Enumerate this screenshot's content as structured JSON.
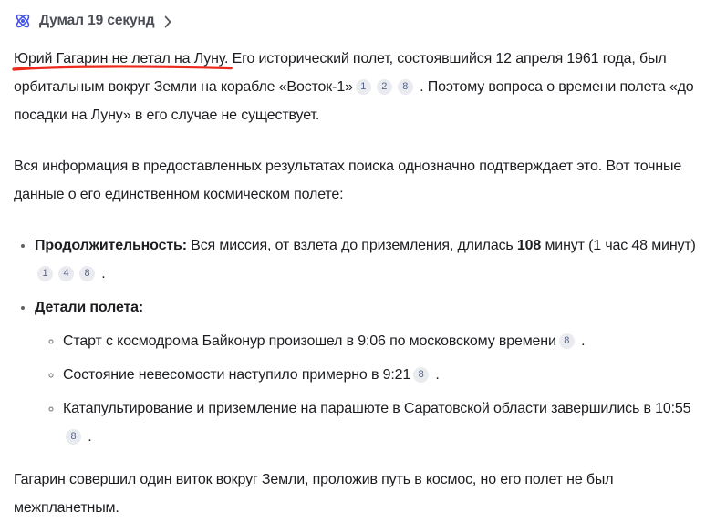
{
  "thinking_header": {
    "icon": "atom-icon",
    "label": "Думал 19 секунд"
  },
  "colors": {
    "accent_blue": "#4355e9",
    "underline_red": "#ee2a1c",
    "badge_bg": "#e9ebef",
    "badge_text": "#55648c",
    "body_text": "#1c1d21",
    "header_text": "#4a4d56"
  },
  "answer": {
    "p1": {
      "underlined": "Юрий Гагарин не летал на Луну.",
      "before_citations": " Его исторический полет, состоявшийся 12 апреля 1961 года, был орбитальным вокруг Земли на корабле «Восток-1»",
      "citations": [
        "1",
        "2",
        "8"
      ],
      "after_citations": " . Поэтому вопроса о времени полета «до посадки на Луну» в его случае не существует."
    },
    "p2": "Вся информация в предоставленных результатах поиска однозначно подтверждает это. Вот точные данные о его единственном космическом полете:",
    "list": {
      "item1": {
        "bold_lead": "Продолжительность:",
        "text_a": " Вся миссия, от взлета до приземления, длилась ",
        "bold_value": "108",
        "text_b": " минут (1 час 48 минут)",
        "citations": [
          "1",
          "4",
          "8"
        ],
        "tail": " ."
      },
      "item2": {
        "bold_lead": "Детали полета:",
        "sub_items": {
          "sub1": {
            "text": "Старт с космодрома Байконур произошел в 9:06 по московскому времени",
            "citations": [
              "8"
            ],
            "tail": " ."
          },
          "sub2": {
            "text": "Состояние невесомости наступило примерно в 9:21",
            "citations": [
              "8"
            ],
            "tail": " ."
          },
          "sub3": {
            "text": "Катапультирование и приземление на парашюте в Саратовской области завершились в 10:55",
            "citations": [
              "8"
            ],
            "tail": " ."
          }
        }
      }
    },
    "p3": "Гагарин совершил один виток вокруг Земли, проложив путь в космос, но его полет не был межпланетным."
  }
}
